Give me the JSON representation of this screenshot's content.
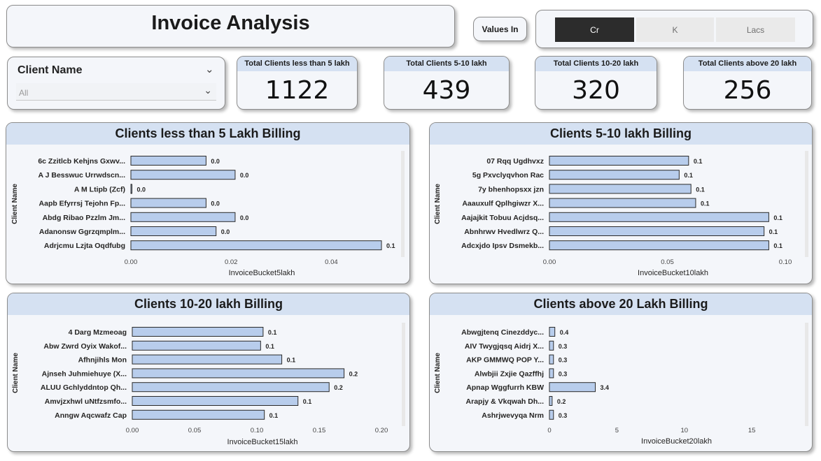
{
  "header": {
    "title": "Invoice Analysis"
  },
  "values_in": {
    "label": "Values In"
  },
  "unit_selector": {
    "options": [
      {
        "label": "Cr",
        "selected": true
      },
      {
        "label": "K",
        "selected": false
      },
      {
        "label": "Lacs",
        "selected": false
      }
    ]
  },
  "client_slicer": {
    "label": "Client Name",
    "value": "All"
  },
  "kpis": [
    {
      "label": "Total Clients less than 5 lakh",
      "value": "1122"
    },
    {
      "label": "Total Clients 5-10 lakh",
      "value": "439"
    },
    {
      "label": "Total Clients 10-20 lakh",
      "value": "320"
    },
    {
      "label": "Total Clients above 20 lakh",
      "value": "256"
    }
  ],
  "colors": {
    "bar_fill": "#b8cdec",
    "bar_stroke": "#2a2a2a",
    "header_bg": "#d5e1f2",
    "selected_unit": "#2c2c2c"
  },
  "chart_data": [
    {
      "type": "bar",
      "orientation": "horizontal",
      "title": "Clients less than 5 Lakh Billing",
      "xlabel": "InvoiceBucket5lakh",
      "ylabel": "Client Name",
      "xlim": [
        0,
        0.05
      ],
      "xticks": [
        "0.00",
        "0.02",
        "0.04"
      ],
      "xtick_values": [
        0,
        0.02,
        0.04
      ],
      "categories": [
        "6c Zzitlcb Kehjns Gxwv...",
        "A J Besswuc Urrwdscn...",
        "A M Ltipb (Zcf)",
        "Aapb Efyrrsj Tejohn Fp...",
        "Abdg Ribao Pzzlm Jm...",
        "Adanonsw Ggrzqmplm...",
        "Adrjcmu Lzjta Oqdfubg"
      ],
      "values": [
        0.015,
        0.0208,
        0.0002,
        0.015,
        0.0208,
        0.017,
        0.05
      ],
      "data_labels": [
        "0.0",
        "0.0",
        "0.0",
        "0.0",
        "0.0",
        "0.0",
        "0.1"
      ]
    },
    {
      "type": "bar",
      "orientation": "horizontal",
      "title": "Clients 5-10 lakh Billing",
      "xlabel": "InvoiceBucket10lakh",
      "ylabel": "Client Name",
      "xlim": [
        0,
        0.1
      ],
      "xticks": [
        "0.00",
        "0.05",
        "0.10"
      ],
      "xtick_values": [
        0,
        0.05,
        0.1
      ],
      "categories": [
        "07 Rqq Ugdhvxz",
        "5g Pxvclyqvhon Rac",
        "7y bhenhopsxx jzn",
        "Aaauxulf Qplhgiwzr X...",
        "Aajajkit Tobuu Acjdsq...",
        "Abnhrwv Hvedlwrz Q...",
        "Adcxjdo Ipsv Dsmekb..."
      ],
      "values": [
        0.059,
        0.055,
        0.06,
        0.062,
        0.093,
        0.091,
        0.093
      ],
      "data_labels": [
        "0.1",
        "0.1",
        "0.1",
        "0.1",
        "0.1",
        "0.1",
        "0.1"
      ]
    },
    {
      "type": "bar",
      "orientation": "horizontal",
      "title": "Clients 10-20 lakh Billing",
      "xlabel": "InvoiceBucket15lakh",
      "ylabel": "Client Name",
      "xlim": [
        0,
        0.2
      ],
      "xticks": [
        "0.00",
        "0.05",
        "0.10",
        "0.15",
        "0.20"
      ],
      "xtick_values": [
        0,
        0.05,
        0.1,
        0.15,
        0.2
      ],
      "categories": [
        "4 Darg Mzmeoag",
        "Abw Zwrd Oyix Wakof...",
        "Afhnjihls Mon",
        "Ajnseh Juhmiehuye (X...",
        "ALUU Gchlyddntop Qh...",
        "Amvjzxhwl uNtfzsmfo...",
        "Anngw Aqcwafz Cap"
      ],
      "values": [
        0.105,
        0.103,
        0.12,
        0.17,
        0.158,
        0.133,
        0.106
      ],
      "data_labels": [
        "0.1",
        "0.1",
        "0.1",
        "0.2",
        "0.2",
        "0.1",
        "0.1"
      ]
    },
    {
      "type": "bar",
      "orientation": "horizontal",
      "title": "Clients above 20 Lakh Billing",
      "xlabel": "InvoiceBucket20lakh",
      "ylabel": "Client Name",
      "xlim": [
        0,
        18
      ],
      "xticks": [
        "0",
        "5",
        "10",
        "15"
      ],
      "xtick_values": [
        0,
        5,
        10,
        15
      ],
      "categories": [
        "Abwgjtenq Cinezddyc...",
        "AIV Twygjqsq Aidrj X...",
        "AKP GMMWQ POP Y...",
        "Alwbjii Zxjie Qazffhj",
        "Apnap Wggfurrh KBW",
        "Arapjy & Vkqwah Dh...",
        "Ashrjwevyqa Nrm"
      ],
      "values": [
        0.4,
        0.3,
        0.3,
        0.3,
        3.4,
        0.2,
        0.3
      ],
      "data_labels": [
        "0.4",
        "0.3",
        "0.3",
        "0.3",
        "3.4",
        "0.2",
        "0.3"
      ]
    }
  ]
}
